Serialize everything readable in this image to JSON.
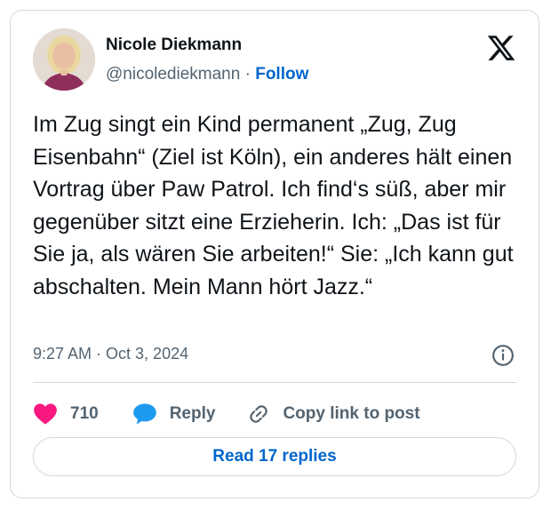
{
  "author": {
    "name": "Nicole Diekmann",
    "handle": "@nicolediekmann",
    "separator": "·",
    "follow_label": "Follow"
  },
  "tweet": {
    "text": "Im Zug singt ein Kind permanent „Zug, Zug Eisenbahn“ (Ziel ist Köln), ein anderes hält einen Vortrag über Paw Patrol. Ich find‘s süß, aber mir gegenüber sitzt eine Erzieherin. Ich: „Das ist für Sie ja, als wären Sie arbeiten!“ Sie: „Ich kann gut abschalten. Mein Mann hört Jazz.“",
    "timestamp": "9:27 AM · Oct 3, 2024"
  },
  "actions": {
    "like_count": "710",
    "reply_label": "Reply",
    "copy_link_label": "Copy link to post"
  },
  "read_replies_label": "Read 17 replies",
  "icons": {
    "brand": "x-logo-icon",
    "info": "info-icon",
    "like": "heart-icon",
    "reply": "speech-bubble-icon",
    "copy": "link-icon"
  },
  "colors": {
    "accent": "#0066cc",
    "like": "#f91880",
    "reply": "#1d9bf0",
    "muted": "#536471",
    "border": "#cfd9de"
  }
}
